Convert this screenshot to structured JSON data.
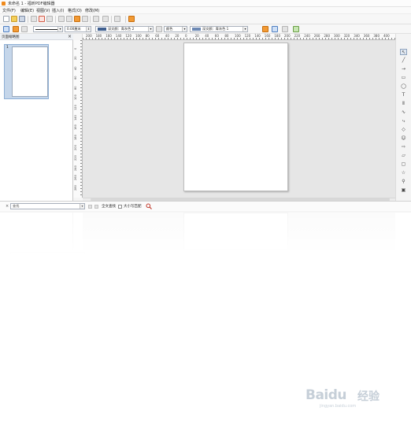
{
  "window": {
    "title": "未命名 1 - 福昕PDF编辑器"
  },
  "menubar": {
    "items": [
      "文件(F)",
      "编辑(E)",
      "视图(V)",
      "插入(I)",
      "格式(O)",
      "修改(M)"
    ]
  },
  "toolbar2": {
    "line_width": "0.00厘米",
    "fill_color": "深文颜：青灰色 2",
    "area_label": "颜色",
    "line_color": "深文颜：青灰色 1"
  },
  "thumbnail_panel": {
    "title": "页面缩略图",
    "close": "×",
    "pages": [
      {
        "number": "1"
      }
    ]
  },
  "ruler": {
    "h_labels": [
      "200",
      "180",
      "160",
      "140",
      "120",
      "100",
      "80",
      "60",
      "40",
      "20",
      "0",
      "20",
      "40",
      "60",
      "80",
      "100",
      "120",
      "140",
      "160",
      "180",
      "200",
      "220",
      "240",
      "260",
      "280",
      "300",
      "320",
      "340",
      "360",
      "380",
      "400"
    ],
    "v_labels": [
      "0",
      "20",
      "40",
      "60",
      "80",
      "100",
      "120",
      "140",
      "160",
      "180",
      "200",
      "220",
      "240",
      "260",
      "280"
    ]
  },
  "right_tools": [
    {
      "name": "select-tool-icon",
      "glyph": "↖"
    },
    {
      "name": "line-tool-icon",
      "glyph": "╱"
    },
    {
      "name": "arrow-line-tool-icon",
      "glyph": "→"
    },
    {
      "name": "rectangle-tool-icon",
      "glyph": "▭"
    },
    {
      "name": "ellipse-tool-icon",
      "glyph": "◯"
    },
    {
      "name": "text-tool-icon",
      "glyph": "T"
    },
    {
      "name": "vertical-text-tool-icon",
      "glyph": "Ⅱ"
    },
    {
      "name": "curve-tool-icon",
      "glyph": "∿"
    },
    {
      "name": "connector-tool-icon",
      "glyph": "⤷"
    },
    {
      "name": "basic-shapes-icon",
      "glyph": "◇"
    },
    {
      "name": "symbol-shapes-icon",
      "glyph": "☺"
    },
    {
      "name": "block-arrows-icon",
      "glyph": "⇨"
    },
    {
      "name": "flowchart-icon",
      "glyph": "▱"
    },
    {
      "name": "callouts-icon",
      "glyph": "▢"
    },
    {
      "name": "stars-icon",
      "glyph": "☆"
    },
    {
      "name": "points-icon",
      "glyph": "⚲"
    },
    {
      "name": "image-tool-icon",
      "glyph": "▣"
    }
  ],
  "findbar": {
    "close": "×",
    "search_placeholder": "查找",
    "whole_words": "全文查找",
    "match_case": "大小写匹配"
  },
  "watermark": {
    "brand": "Baidu",
    "suffix": "经验",
    "url": "jingyan.baidu.com"
  }
}
